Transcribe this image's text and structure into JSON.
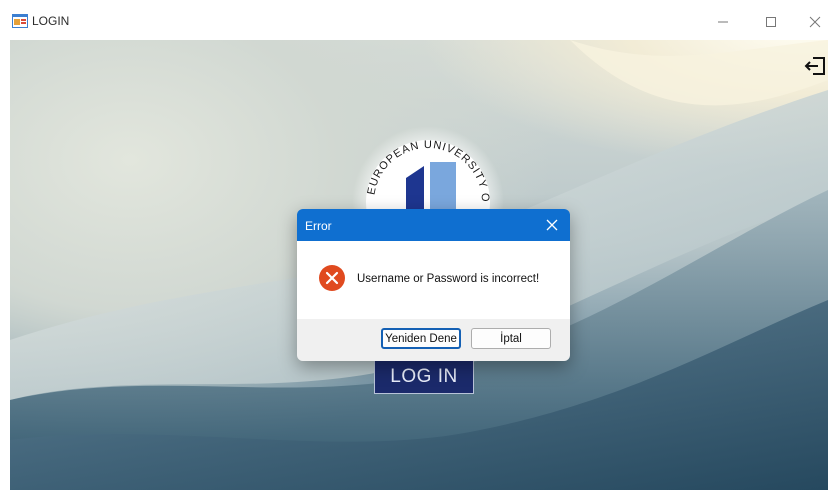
{
  "window": {
    "title": "LOGIN"
  },
  "logo": {
    "text": "EUROPEAN UNIVERSITY OF LEFKE"
  },
  "login_button": {
    "label": "LOG IN"
  },
  "dialog": {
    "title": "Error",
    "message": "Username or Password is incorrect!",
    "retry_label": "Yeniden Dene",
    "cancel_label": "İptal"
  },
  "colors": {
    "dialog_title_bg": "#0f6fd0",
    "error_icon": "#e04a1f",
    "login_button_bg": "#1b2a6b",
    "logo_blue_dark": "#1e3690",
    "logo_blue_light": "#7aa7dd"
  },
  "icons": {
    "app": "app-form-icon",
    "exit": "exit-icon",
    "error": "error-icon",
    "close": "close-icon"
  }
}
